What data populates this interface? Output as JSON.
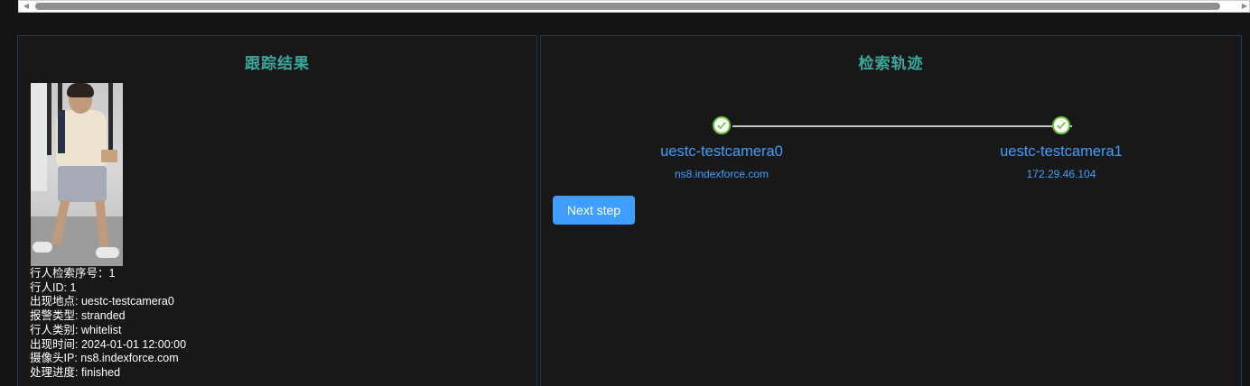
{
  "tracking_panel": {
    "title": "跟踪结果",
    "person_info": [
      {
        "label": "行人检索序号：",
        "value": "1"
      },
      {
        "label": "行人ID: ",
        "value": "1"
      },
      {
        "label": "出现地点: ",
        "value": "uestc-testcamera0"
      },
      {
        "label": "报警类型: ",
        "value": "stranded"
      },
      {
        "label": "行人类别: ",
        "value": "whitelist"
      },
      {
        "label": "出现时间: ",
        "value": "2024-01-01 12:00:00"
      },
      {
        "label": "摄像头IP: ",
        "value": "ns8.indexforce.com"
      },
      {
        "label": "处理进度: ",
        "value": "finished"
      }
    ]
  },
  "trajectory_panel": {
    "title": "检索轨迹",
    "steps": [
      {
        "name": "uestc-testcamera0",
        "ip": "ns8.indexforce.com",
        "status": "finished",
        "icon": "check-icon"
      },
      {
        "name": "uestc-testcamera1",
        "ip": "172.29.46.104",
        "status": "finished",
        "icon": "check-icon"
      }
    ],
    "next_button_label": "Next step"
  },
  "colors": {
    "accent_blue": "#409eff",
    "success_green": "#67c23a",
    "title_teal": "#3aa99f"
  }
}
